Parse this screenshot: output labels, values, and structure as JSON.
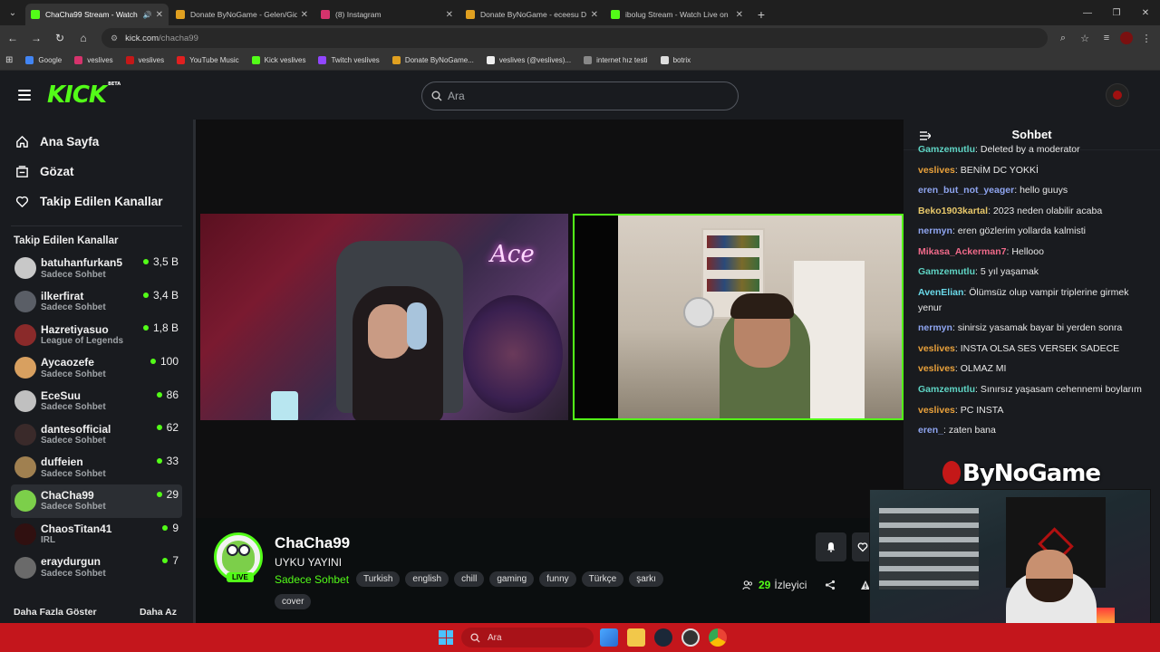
{
  "browser": {
    "tabs": [
      {
        "title": "ChaCha99 Stream - Watch L",
        "active": true,
        "audio": true,
        "color": "#53fc18"
      },
      {
        "title": "Donate ByNoGame - Gelen/Gid",
        "active": false,
        "color": "#e0a020"
      },
      {
        "title": "(8) Instagram",
        "active": false,
        "color": "#d6336c"
      },
      {
        "title": "Donate ByNoGame - eceesu D",
        "active": false,
        "color": "#e0a020"
      },
      {
        "title": "ibolug Stream - Watch Live on",
        "active": false,
        "color": "#53fc18"
      }
    ],
    "url_host": "kick.com",
    "url_path": "/chacha99",
    "bookmarks": [
      {
        "label": "Google",
        "color": "#4285f4"
      },
      {
        "label": "veslives",
        "color": "#d6336c"
      },
      {
        "label": "veslives",
        "color": "#c41818"
      },
      {
        "label": "YouTube Music",
        "color": "#e02020"
      },
      {
        "label": "Kick veslives",
        "color": "#53fc18"
      },
      {
        "label": "Twitch veslives",
        "color": "#9146ff"
      },
      {
        "label": "Donate ByNoGame...",
        "color": "#e0a020"
      },
      {
        "label": "veslives (@veslives)...",
        "color": "#eeeeee"
      },
      {
        "label": "internet hız testi",
        "color": "#888888"
      },
      {
        "label": "botrix",
        "color": "#dddddd"
      }
    ]
  },
  "header": {
    "logo": "KICK",
    "logo_badge": "BETA",
    "search_placeholder": "Ara"
  },
  "sidebar": {
    "nav": [
      {
        "label": "Ana Sayfa",
        "icon": "home-icon"
      },
      {
        "label": "Gözat",
        "icon": "browse-icon"
      },
      {
        "label": "Takip Edilen Kanallar",
        "icon": "heart-icon"
      }
    ],
    "section_title": "Takip Edilen Kanallar",
    "channels": [
      {
        "name": "batuhanfurkan5",
        "category": "Sadece Sohbet",
        "viewers": "3,5 B",
        "avatar": "#c8c8c8"
      },
      {
        "name": "ilkerfirat",
        "category": "Sadece Sohbet",
        "viewers": "3,4 B",
        "avatar": "#5a5e66"
      },
      {
        "name": "Hazretiyasuo",
        "category": "League of Legends",
        "viewers": "1,8 B",
        "avatar": "#8a2a2a"
      },
      {
        "name": "Aycaozefe",
        "category": "Sadece Sohbet",
        "viewers": "100",
        "avatar": "#d8a060"
      },
      {
        "name": "EceSuu",
        "category": "Sadece Sohbet",
        "viewers": "86",
        "avatar": "#c0c0c0"
      },
      {
        "name": "dantesofficial",
        "category": "Sadece Sohbet",
        "viewers": "62",
        "avatar": "#3a2a2a"
      },
      {
        "name": "duffeien",
        "category": "Sadece Sohbet",
        "viewers": "33",
        "avatar": "#a08050"
      },
      {
        "name": "ChaCha99",
        "category": "Sadece Sohbet",
        "viewers": "29",
        "avatar": "#7ccf4a",
        "active": true
      },
      {
        "name": "ChaosTitan41",
        "category": "IRL",
        "viewers": "9",
        "avatar": "#301010"
      },
      {
        "name": "eraydurgun",
        "category": "Sadece Sohbet",
        "viewers": "7",
        "avatar": "#6a6a6a"
      }
    ],
    "show_more": "Daha Fazla Göster",
    "show_less": "Daha Az"
  },
  "stream": {
    "streamer": "ChaCha99",
    "live_label": "LIVE",
    "title": "UYKU YAYINI",
    "category": "Sadece Sohbet",
    "tags": [
      "Turkish",
      "english",
      "chill",
      "gaming",
      "funny",
      "Türkçe",
      "şarkı"
    ],
    "tag_extra": "cover",
    "viewer_count": "29",
    "viewer_label": "İzleyici",
    "neon_sign": "Ace"
  },
  "chat": {
    "title": "Sohbet",
    "messages": [
      {
        "user": "Gamzemutlu",
        "text": "Deleted by a moderator",
        "color": "c-teal",
        "deleted": true
      },
      {
        "user": "veslives",
        "text": "BENİM DC YOKKİ",
        "color": "c-orange"
      },
      {
        "user": "eren_but_not_yeager",
        "text": "hello guuys",
        "color": "c-blue"
      },
      {
        "user": "Beko1903kartal",
        "text": "2023 neden olabilir acaba",
        "color": "c-gold"
      },
      {
        "user": "nermyn",
        "text": "eren gözlerim yollarda kalmisti",
        "color": "c-blue"
      },
      {
        "user": "Mikasa_Ackerman7",
        "text": "Hellooo",
        "color": "c-pink"
      },
      {
        "user": "Gamzemutlu",
        "text": "5 yıl yaşamak",
        "color": "c-teal"
      },
      {
        "user": "AvenElian",
        "text": "Ölümsüz olup vampir triplerine girmek yenur",
        "color": "c-cyan"
      },
      {
        "user": "nermyn",
        "text": "sinirsiz yasamak bayar bi yerden sonra",
        "color": "c-blue"
      },
      {
        "user": "veslives",
        "text": "INSTA OLSA SES VERSEK SADECE",
        "color": "c-orange"
      },
      {
        "user": "veslives",
        "text": "OLMAZ MI",
        "color": "c-orange"
      },
      {
        "user": "Gamzemutlu",
        "text": "Sınırsız yaşasam cehennemi boylarım",
        "color": "c-teal"
      },
      {
        "user": "veslives",
        "text": "PC INSTA",
        "color": "c-orange"
      },
      {
        "user": "eren_",
        "text": "zaten bana",
        "color": "c-blue"
      }
    ]
  },
  "overlay": {
    "watermark": "ByNoGame"
  },
  "taskbar": {
    "search_placeholder": "Ara"
  }
}
